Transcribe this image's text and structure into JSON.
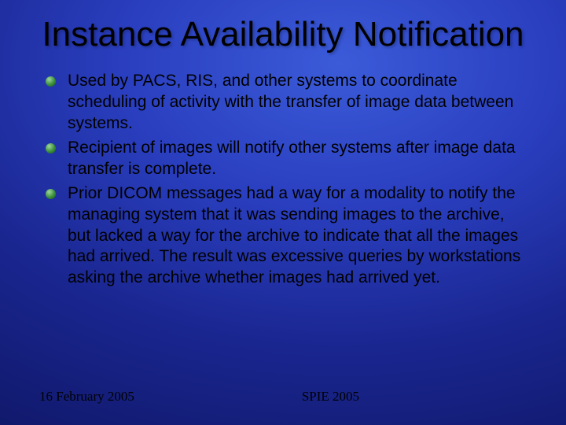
{
  "title": "Instance Availability Notification",
  "bullets": [
    "Used by PACS, RIS, and other systems to coordinate scheduling of activity with the transfer of image data between systems.",
    "Recipient of images will notify other systems after image data transfer is complete.",
    "Prior DICOM messages had a way for a modality to notify the managing system that it was sending images to the archive, but lacked a way for the archive to indicate that all the images had arrived. The result was excessive queries by workstations asking the archive whether images had arrived yet."
  ],
  "footer": {
    "date": "16 February 2005",
    "event": "SPIE 2005"
  }
}
